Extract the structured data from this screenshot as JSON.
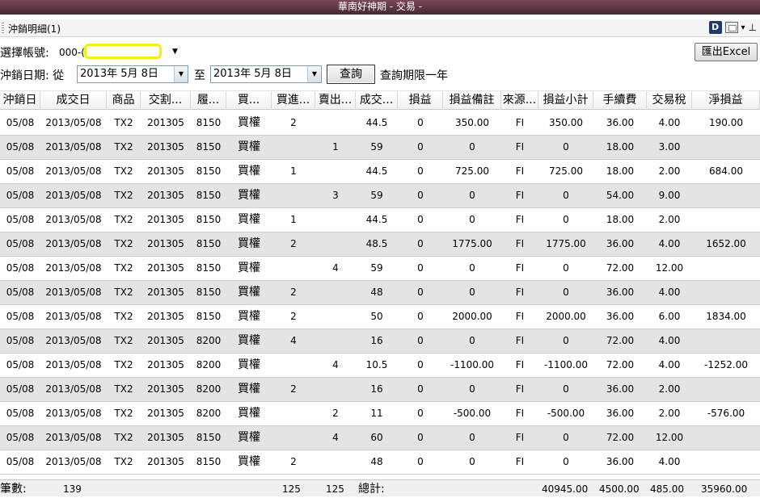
{
  "window": {
    "title": "華南好神期 - 交易 -"
  },
  "panel": {
    "title": "沖銷明細(1)",
    "tool_d": "D",
    "tool_arrow": "▾",
    "tool_pin": "⊥"
  },
  "filters": {
    "account_label": "選擇帳號:",
    "account_value": "000-(",
    "date_label": "沖銷日期: 從",
    "from_date": "2013年 5月 8日",
    "to_label": "至",
    "to_date": "2013年 5月 8日",
    "query_button": "查詢",
    "query_note": "查詢期限一年",
    "export_button": "匯出Excel"
  },
  "icons": {
    "dropdown": "chevron-down-icon",
    "pin": "pin-icon",
    "window": "float-window-icon"
  },
  "columns": [
    "沖銷日",
    "成交日",
    "商品",
    "交割...",
    "履...",
    "買...",
    "買進...",
    "賣出...",
    "成交...",
    "損益",
    "損益備註",
    "來源...",
    "損益小計",
    "手續費",
    "交易稅",
    "淨損益"
  ],
  "rows": [
    [
      "05/08",
      "2013/05/08",
      "TX2",
      "201305",
      "8150",
      "買權",
      "2",
      "",
      "44.5",
      "0",
      "350.00",
      "FI",
      "350.00",
      "36.00",
      "4.00",
      "190.00"
    ],
    [
      "05/08",
      "2013/05/08",
      "TX2",
      "201305",
      "8150",
      "買權",
      "",
      "1",
      "59",
      "0",
      "0",
      "FI",
      "0",
      "18.00",
      "3.00",
      ""
    ],
    [
      "05/08",
      "2013/05/08",
      "TX2",
      "201305",
      "8150",
      "買權",
      "1",
      "",
      "44.5",
      "0",
      "725.00",
      "FI",
      "725.00",
      "18.00",
      "2.00",
      "684.00"
    ],
    [
      "05/08",
      "2013/05/08",
      "TX2",
      "201305",
      "8150",
      "買權",
      "",
      "3",
      "59",
      "0",
      "0",
      "FI",
      "0",
      "54.00",
      "9.00",
      ""
    ],
    [
      "05/08",
      "2013/05/08",
      "TX2",
      "201305",
      "8150",
      "買權",
      "1",
      "",
      "44.5",
      "0",
      "0",
      "FI",
      "0",
      "18.00",
      "2.00",
      ""
    ],
    [
      "05/08",
      "2013/05/08",
      "TX2",
      "201305",
      "8150",
      "買權",
      "2",
      "",
      "48.5",
      "0",
      "1775.00",
      "FI",
      "1775.00",
      "36.00",
      "4.00",
      "1652.00"
    ],
    [
      "05/08",
      "2013/05/08",
      "TX2",
      "201305",
      "8150",
      "買權",
      "",
      "4",
      "59",
      "0",
      "0",
      "FI",
      "0",
      "72.00",
      "12.00",
      ""
    ],
    [
      "05/08",
      "2013/05/08",
      "TX2",
      "201305",
      "8150",
      "買權",
      "2",
      "",
      "48",
      "0",
      "0",
      "FI",
      "0",
      "36.00",
      "4.00",
      ""
    ],
    [
      "05/08",
      "2013/05/08",
      "TX2",
      "201305",
      "8150",
      "買權",
      "2",
      "",
      "50",
      "0",
      "2000.00",
      "FI",
      "2000.00",
      "36.00",
      "6.00",
      "1834.00"
    ],
    [
      "05/08",
      "2013/05/08",
      "TX2",
      "201305",
      "8200",
      "買權",
      "4",
      "",
      "16",
      "0",
      "0",
      "FI",
      "0",
      "72.00",
      "4.00",
      ""
    ],
    [
      "05/08",
      "2013/05/08",
      "TX2",
      "201305",
      "8200",
      "買權",
      "",
      "4",
      "10.5",
      "0",
      "-1100.00",
      "FI",
      "-1100.00",
      "72.00",
      "4.00",
      "-1252.00"
    ],
    [
      "05/08",
      "2013/05/08",
      "TX2",
      "201305",
      "8200",
      "買權",
      "2",
      "",
      "16",
      "0",
      "0",
      "FI",
      "0",
      "36.00",
      "2.00",
      ""
    ],
    [
      "05/08",
      "2013/05/08",
      "TX2",
      "201305",
      "8200",
      "買權",
      "",
      "2",
      "11",
      "0",
      "-500.00",
      "FI",
      "-500.00",
      "36.00",
      "2.00",
      "-576.00"
    ],
    [
      "05/08",
      "2013/05/08",
      "TX2",
      "201305",
      "8150",
      "買權",
      "",
      "4",
      "60",
      "0",
      "0",
      "FI",
      "0",
      "72.00",
      "12.00",
      ""
    ],
    [
      "05/08",
      "2013/05/08",
      "TX2",
      "201305",
      "8150",
      "買權",
      "2",
      "",
      "48",
      "0",
      "0",
      "FI",
      "0",
      "36.00",
      "4.00",
      ""
    ]
  ],
  "footer": {
    "count_label": "筆數:",
    "count": "139",
    "buy_total": "125",
    "sell_total": "125",
    "total_label": "總計:",
    "pl_subtotal": "40945.00",
    "fee_total": "4500.00",
    "tax_total": "485.00",
    "net_total": "35960.00"
  }
}
